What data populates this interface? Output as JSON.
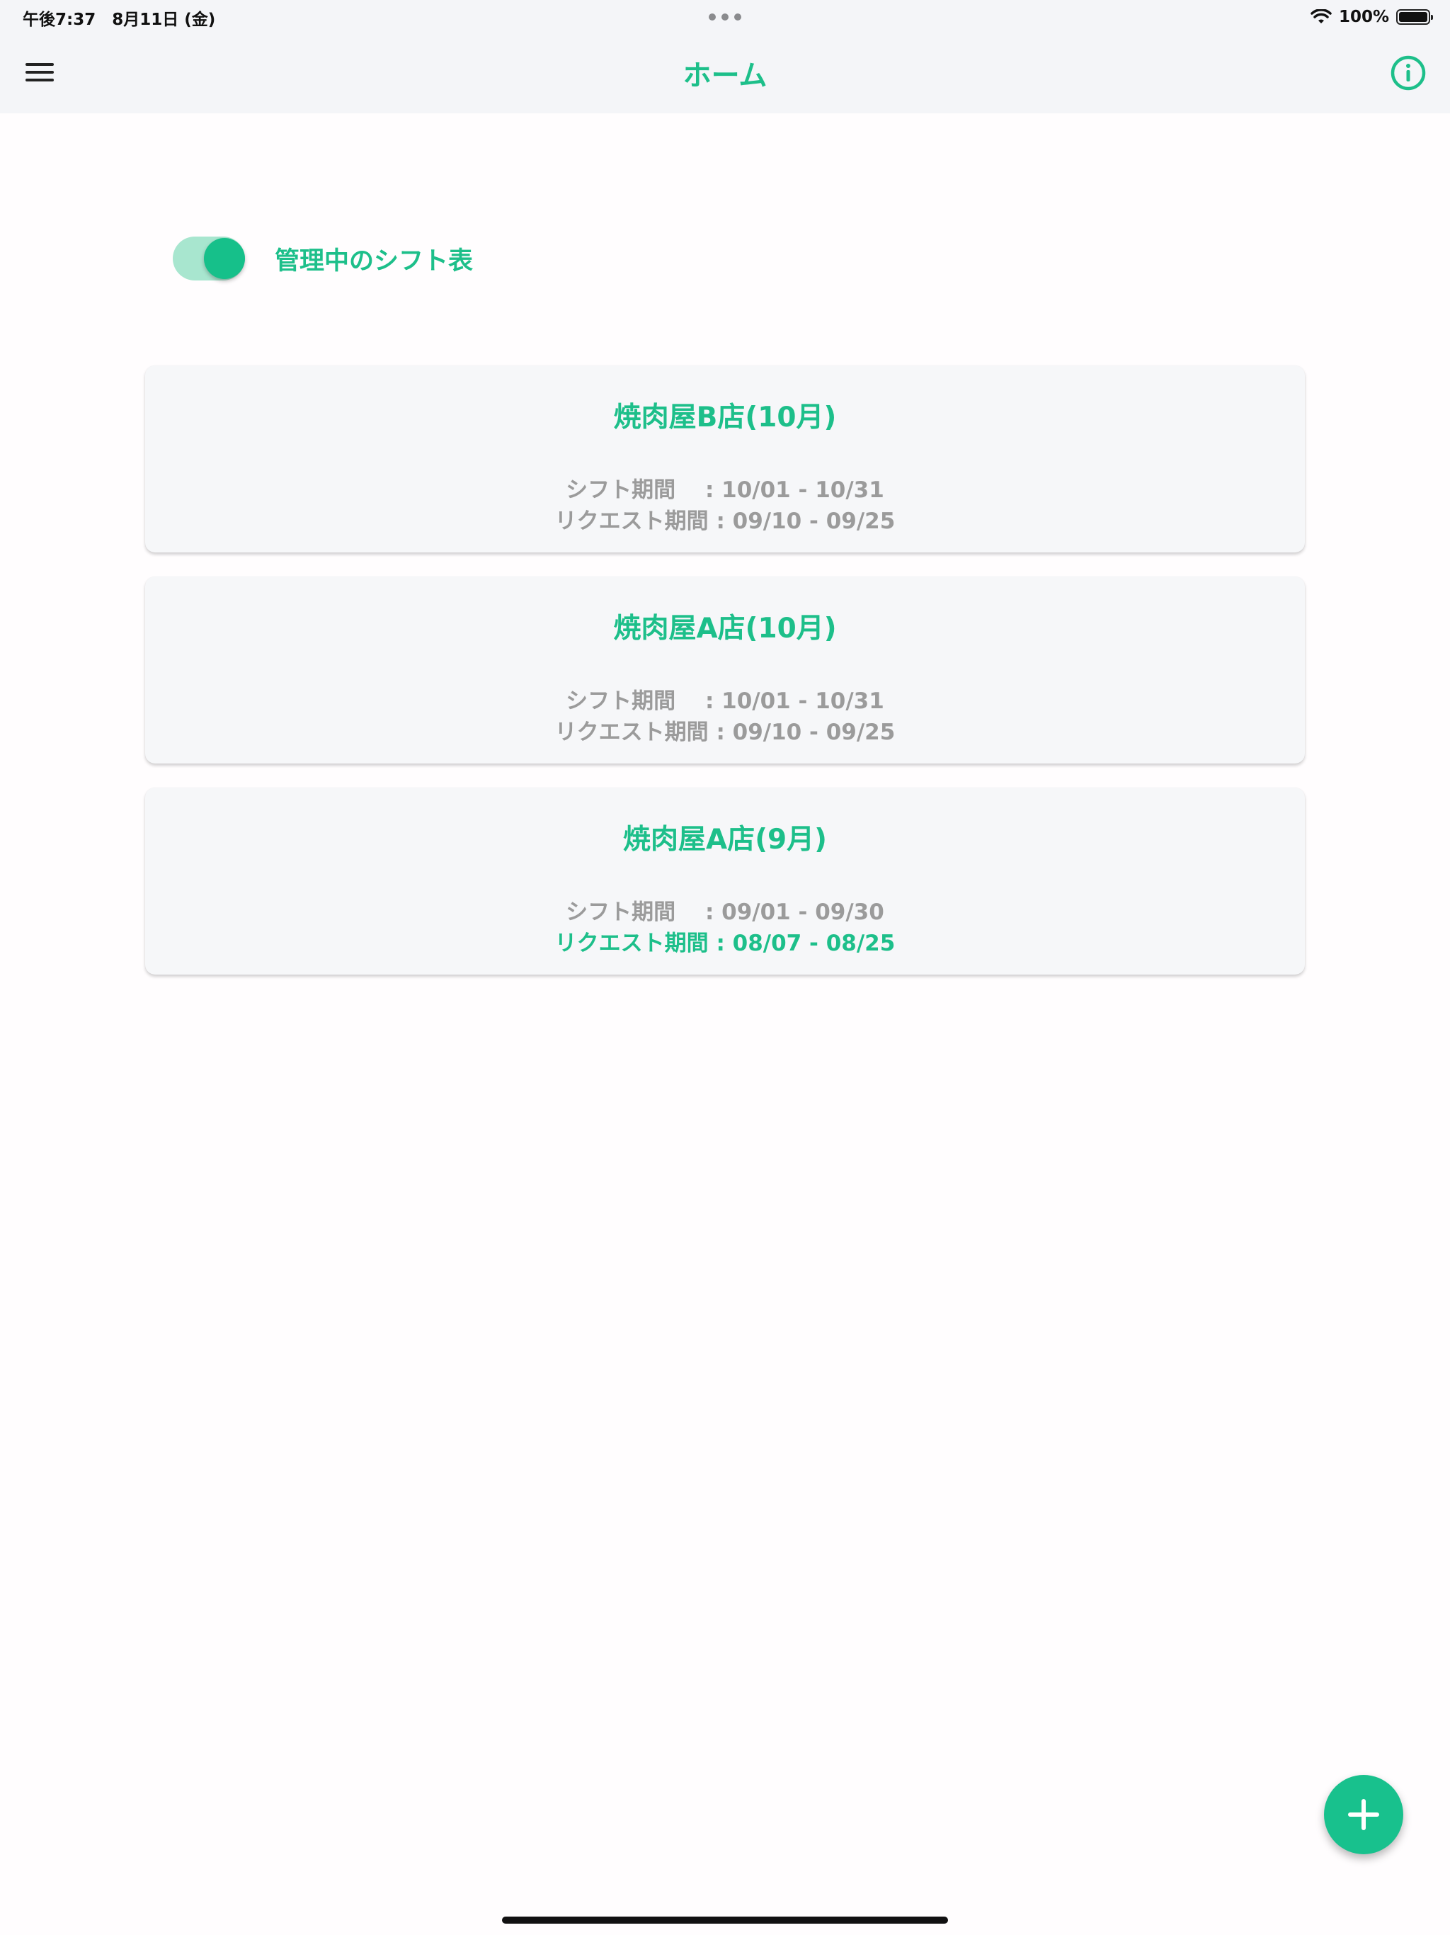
{
  "status_bar": {
    "time_date": "午後7:37　8月11日 (金)",
    "battery_percent": "100%",
    "wifi_icon": "wifi-icon",
    "battery_level": 1.0
  },
  "nav": {
    "title": "ホーム",
    "menu_icon": "hamburger-menu-icon",
    "info_icon": "info-icon"
  },
  "toggle": {
    "label": "管理中のシフト表",
    "on": true
  },
  "cards": [
    {
      "title": "焼肉屋B店(10月)",
      "shift_period": "シフト期間　 : 10/01 - 10/31",
      "request_period": "リクエスト期間 : 09/10 - 09/25",
      "request_active": false
    },
    {
      "title": "焼肉屋A店(10月)",
      "shift_period": "シフト期間　 : 10/01 - 10/31",
      "request_period": "リクエスト期間 : 09/10 - 09/25",
      "request_active": false
    },
    {
      "title": "焼肉屋A店(9月)",
      "shift_period": "シフト期間　 : 09/01 - 09/30",
      "request_period": "リクエスト期間 : 08/07 - 08/25",
      "request_active": true
    }
  ],
  "fab": {
    "icon": "plus-icon"
  },
  "colors": {
    "accent": "#1dbf8a",
    "muted_text": "#9b9b9b",
    "bar_bg": "#f4f5f8",
    "card_bg": "#f6f7f9"
  }
}
